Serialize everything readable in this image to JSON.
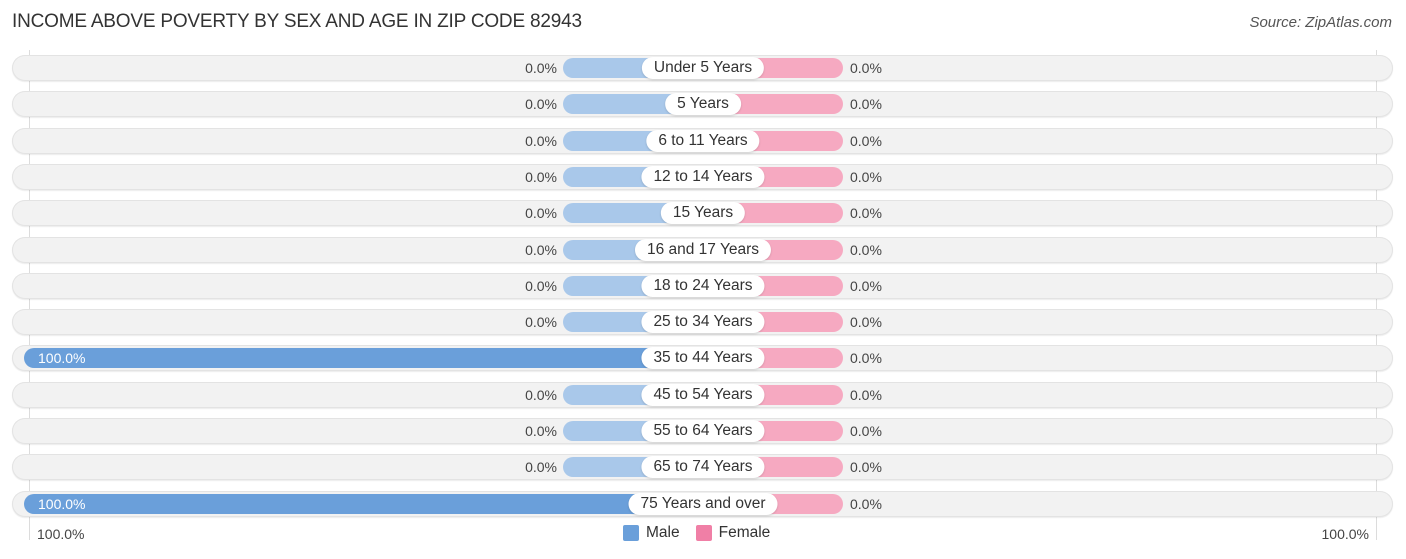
{
  "chart_data": {
    "type": "bar",
    "orientation": "horizontal-diverging",
    "title": "INCOME ABOVE POVERTY BY SEX AND AGE IN ZIP CODE 82943",
    "source": "Source: ZipAtlas.com",
    "categories": [
      "Under 5 Years",
      "5 Years",
      "6 to 11 Years",
      "12 to 14 Years",
      "15 Years",
      "16 and 17 Years",
      "18 to 24 Years",
      "25 to 34 Years",
      "35 to 44 Years",
      "45 to 54 Years",
      "55 to 64 Years",
      "65 to 74 Years",
      "75 Years and over"
    ],
    "series": [
      {
        "name": "Male",
        "color": "#6a9fda",
        "values": [
          0,
          0,
          0,
          0,
          0,
          0,
          0,
          0,
          100,
          0,
          0,
          0,
          100
        ],
        "labels": [
          "0.0%",
          "0.0%",
          "0.0%",
          "0.0%",
          "0.0%",
          "0.0%",
          "0.0%",
          "0.0%",
          "100.0%",
          "0.0%",
          "0.0%",
          "0.0%",
          "100.0%"
        ]
      },
      {
        "name": "Female",
        "color": "#f07fa6",
        "values": [
          0,
          0,
          0,
          0,
          0,
          0,
          0,
          0,
          0,
          0,
          0,
          0,
          0
        ],
        "labels": [
          "0.0%",
          "0.0%",
          "0.0%",
          "0.0%",
          "0.0%",
          "0.0%",
          "0.0%",
          "0.0%",
          "0.0%",
          "0.0%",
          "0.0%",
          "0.0%",
          "0.0%"
        ]
      }
    ],
    "xlim": [
      -100,
      100
    ],
    "axis_left_label": "100.0%",
    "axis_right_label": "100.0%",
    "unit": "%",
    "legend_position": "bottom-center",
    "grid": false
  }
}
